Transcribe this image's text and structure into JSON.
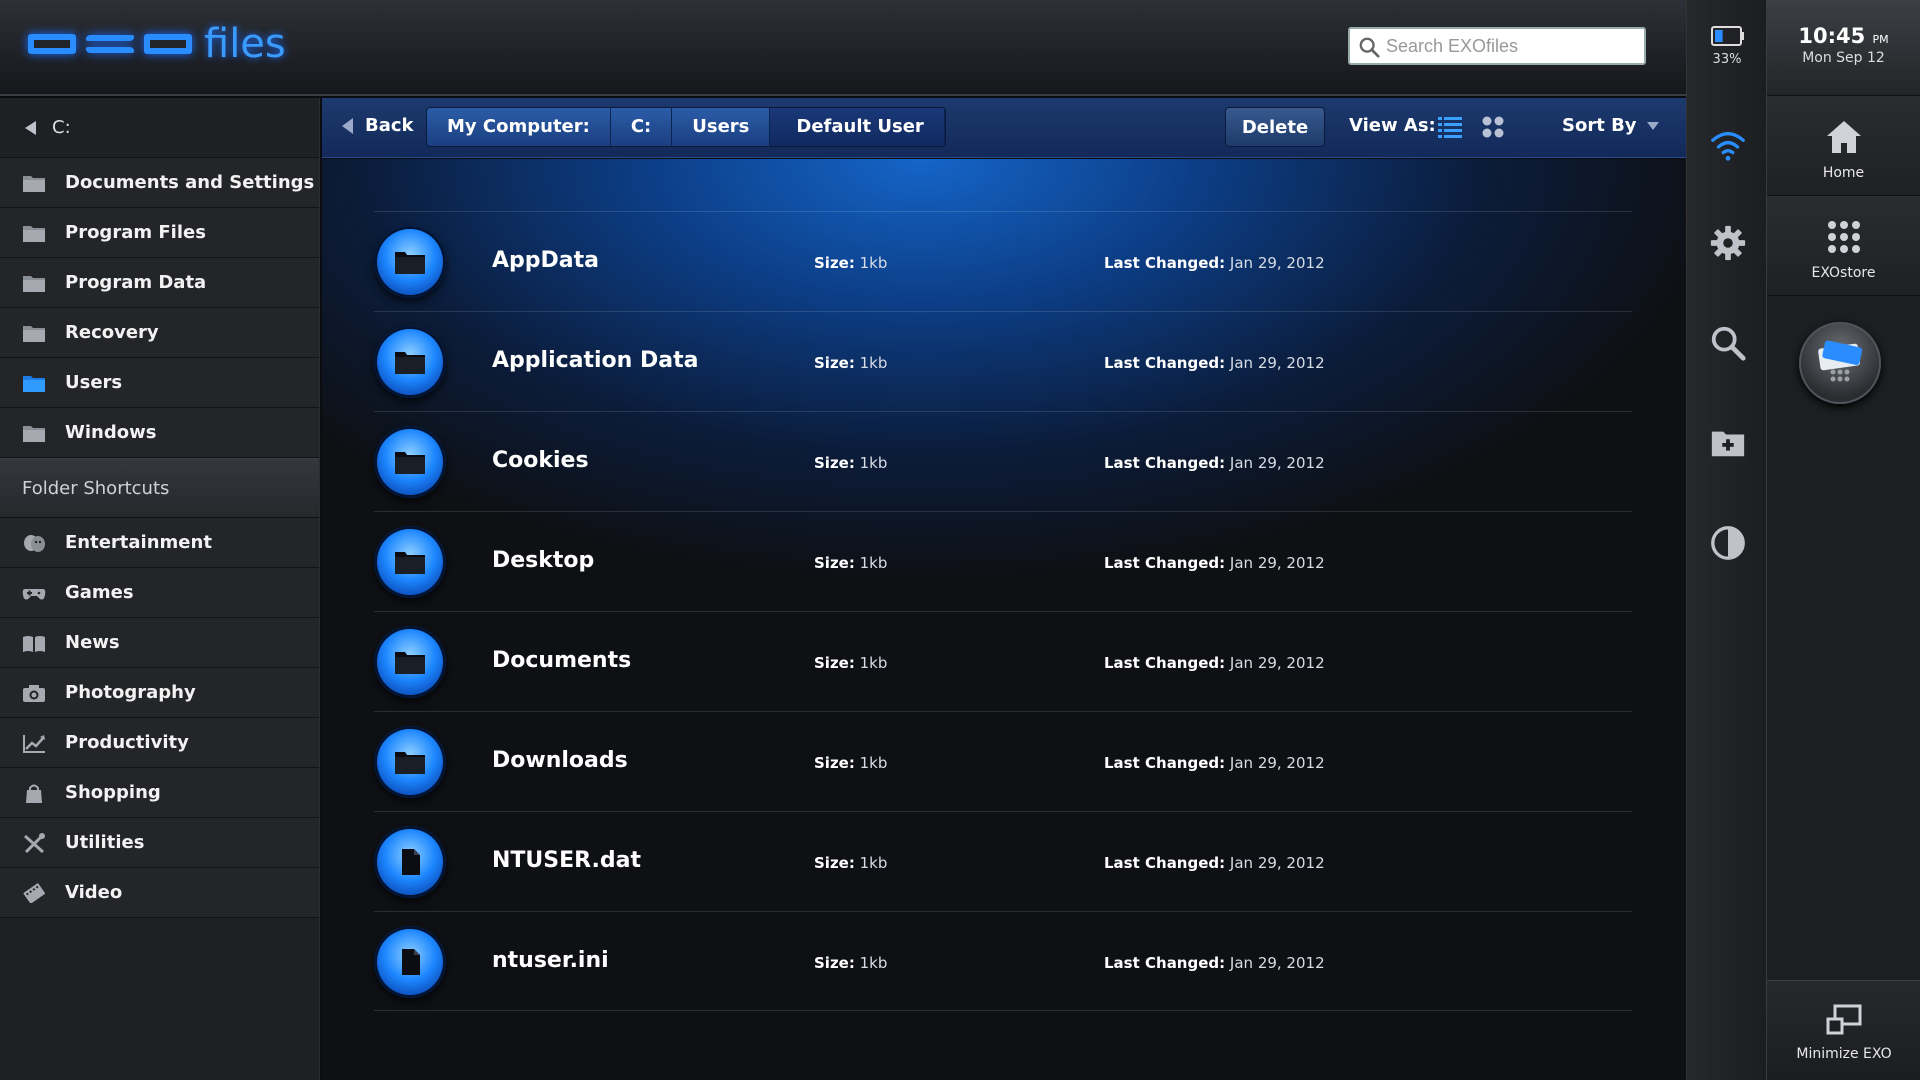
{
  "app": {
    "logo_text": "files"
  },
  "search": {
    "placeholder": "Search EXOfiles"
  },
  "sidebar": {
    "drive_label": "C:",
    "folders": [
      {
        "label": "Documents and Settings",
        "icon": "folder-icon"
      },
      {
        "label": "Program Files",
        "icon": "folder-icon"
      },
      {
        "label": "Program Data",
        "icon": "folder-icon"
      },
      {
        "label": "Recovery",
        "icon": "folder-icon"
      },
      {
        "label": "Users",
        "icon": "folder-icon",
        "selected": true
      },
      {
        "label": "Windows",
        "icon": "folder-icon"
      }
    ],
    "shortcuts_title": "Folder Shortcuts",
    "shortcuts": [
      {
        "label": "Entertainment",
        "icon": "theater-masks-icon"
      },
      {
        "label": "Games",
        "icon": "gamepad-icon"
      },
      {
        "label": "News",
        "icon": "open-book-icon"
      },
      {
        "label": "Photography",
        "icon": "camera-icon"
      },
      {
        "label": "Productivity",
        "icon": "line-chart-icon"
      },
      {
        "label": "Shopping",
        "icon": "shopping-bag-icon"
      },
      {
        "label": "Utilities",
        "icon": "tools-icon"
      },
      {
        "label": "Video",
        "icon": "film-icon"
      }
    ]
  },
  "toolbar": {
    "back_label": "Back",
    "breadcrumbs": [
      "My Computer:",
      "C:",
      "Users",
      "Default User"
    ],
    "delete_label": "Delete",
    "view_as_label": "View As:",
    "sort_by_label": "Sort By"
  },
  "files": {
    "size_label": "Size:",
    "date_label": "Last Changed:",
    "rows": [
      {
        "name": "AppData",
        "size": "1kb",
        "date": "Jan 29, 2012",
        "type": "folder"
      },
      {
        "name": "Application Data",
        "size": "1kb",
        "date": "Jan 29, 2012",
        "type": "folder"
      },
      {
        "name": "Cookies",
        "size": "1kb",
        "date": "Jan 29, 2012",
        "type": "folder"
      },
      {
        "name": "Desktop",
        "size": "1kb",
        "date": "Jan 29, 2012",
        "type": "folder"
      },
      {
        "name": "Documents",
        "size": "1kb",
        "date": "Jan 29, 2012",
        "type": "folder"
      },
      {
        "name": "Downloads",
        "size": "1kb",
        "date": "Jan 29, 2012",
        "type": "folder"
      },
      {
        "name": "NTUSER.dat",
        "size": "1kb",
        "date": "Jan 29, 2012",
        "type": "file"
      },
      {
        "name": "ntuser.ini",
        "size": "1kb",
        "date": "Jan 29, 2012",
        "type": "file"
      }
    ]
  },
  "status": {
    "battery_percent": "33%",
    "battery_level": 0.33
  },
  "panel": {
    "time": "10:45",
    "ampm": "PM",
    "date": "Mon Sep 12",
    "home_label": "Home",
    "store_label": "EXOstore",
    "minimize_label": "Minimize EXO"
  },
  "colors": {
    "accent": "#2a8dff",
    "toolbar": "#1d3a6e",
    "sidebar": "#232529"
  }
}
